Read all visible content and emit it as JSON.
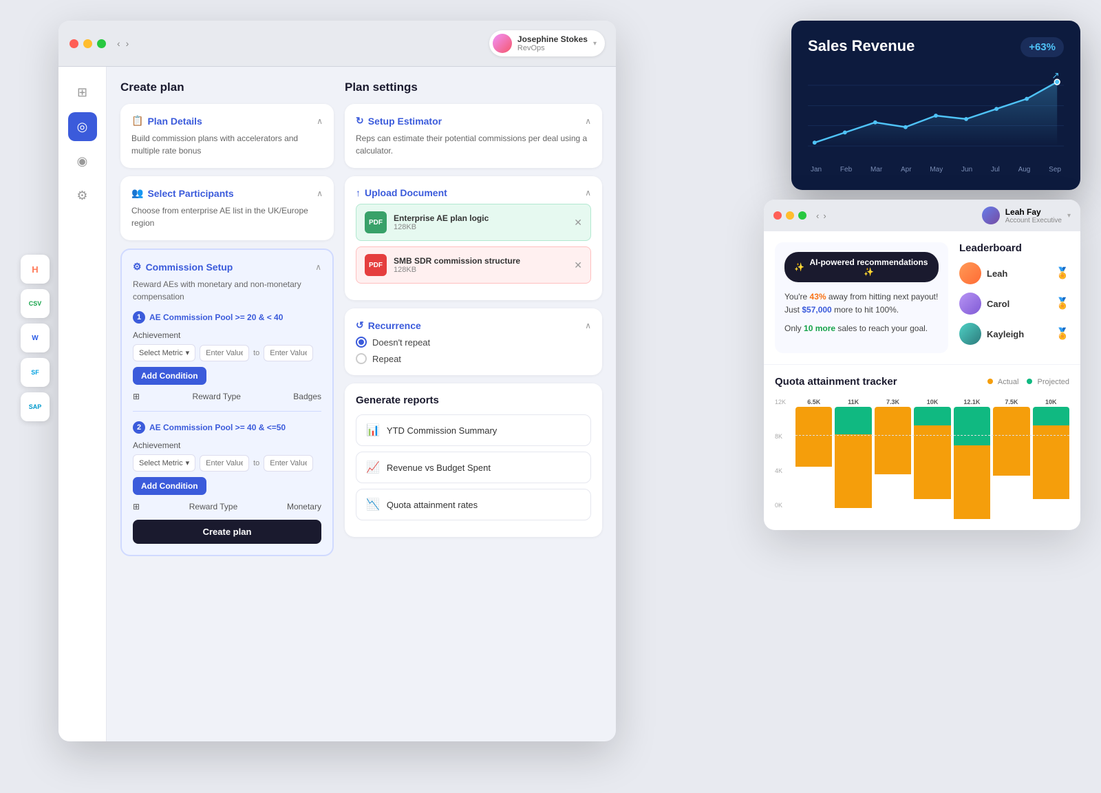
{
  "mainWindow": {
    "title": "Create plan",
    "user": {
      "name": "Josephine Stokes",
      "role": "RevOps"
    }
  },
  "sidebar": {
    "items": [
      {
        "id": "grid",
        "icon": "⊞",
        "label": "Dashboard"
      },
      {
        "id": "target",
        "icon": "◎",
        "label": "Plans",
        "active": true
      },
      {
        "id": "camera",
        "icon": "◉",
        "label": "Media"
      },
      {
        "id": "settings",
        "icon": "⚙",
        "label": "Settings"
      }
    ]
  },
  "integrations": [
    {
      "id": "hubspot",
      "label": "H",
      "color": "#ff7a59",
      "bg": "white"
    },
    {
      "id": "csv",
      "label": "CSV",
      "color": "#16a34a",
      "bg": "white"
    },
    {
      "id": "word",
      "label": "W",
      "color": "#2b5ce6",
      "bg": "white"
    },
    {
      "id": "salesforce",
      "label": "SF",
      "color": "#00a1e0",
      "bg": "white"
    },
    {
      "id": "sap",
      "label": "SAP",
      "color": "#0099cc",
      "bg": "white"
    }
  ],
  "createPlan": {
    "title": "Create plan",
    "sections": {
      "planDetails": {
        "title": "Plan Details",
        "description": "Build commission plans with accelerators and multiple rate bonus",
        "icon": "📋"
      },
      "selectParticipants": {
        "title": "Select Participants",
        "description": "Choose from enterprise AE list in the UK/Europe region",
        "icon": "👥"
      },
      "commissionSetup": {
        "title": "Commission Setup",
        "description": "Reward AEs with monetary and non-monetary compensation",
        "icon": "⚙"
      }
    },
    "pools": [
      {
        "number": "1",
        "label": "AE Commission Pool >= 20 & < 40",
        "achievement": "Achievement",
        "selectMetric": "Select Metric",
        "enterValue1": "Enter Value",
        "enterValue2": "Enter Value",
        "addCondition": "Add Condition",
        "rewardType": "Reward Type",
        "rewardValue": "Badges"
      },
      {
        "number": "2",
        "label": "AE Commission Pool >= 40 & <=50",
        "achievement": "Achievement",
        "selectMetric": "Select Metric",
        "enterValue1": "Enter Value",
        "enterValue2": "Enter Value",
        "addCondition": "Add Condition",
        "rewardType": "Reward Type",
        "rewardValue": "Monetary"
      }
    ],
    "createBtn": "Create plan"
  },
  "planSettings": {
    "title": "Plan settings",
    "setupEstimator": {
      "title": "Setup Estimator",
      "description": "Reps can estimate their potential commissions per deal using a calculator."
    },
    "uploadDocument": {
      "title": "Upload Document",
      "files": [
        {
          "name": "Enterprise AE plan logic",
          "size": "128KB",
          "color": "green"
        },
        {
          "name": "SMB SDR commission structure",
          "size": "128KB",
          "color": "red"
        }
      ]
    },
    "recurrence": {
      "title": "Recurrence",
      "options": [
        {
          "label": "Doesn't repeat",
          "selected": true
        },
        {
          "label": "Repeat",
          "selected": false
        }
      ]
    }
  },
  "generateReports": {
    "title": "Generate reports",
    "reports": [
      {
        "label": "YTD Commission Summary",
        "icon": "📊"
      },
      {
        "label": "Revenue vs Budget Spent",
        "icon": "📈"
      },
      {
        "label": "Quota attainment rates",
        "icon": "📉"
      }
    ]
  },
  "salesRevenue": {
    "title": "Sales Revenue",
    "badge": "+63%",
    "months": [
      "Jan",
      "Feb",
      "Mar",
      "Apr",
      "May",
      "Jun",
      "Jul",
      "Aug",
      "Sep"
    ],
    "chartData": [
      30,
      45,
      60,
      55,
      70,
      65,
      80,
      90,
      110
    ]
  },
  "leaderboardPanel": {
    "user": {
      "name": "Leah Fay",
      "role": "Account Executive"
    },
    "aiRecs": {
      "btnLabel": "AI-powered recommendations ✨",
      "text1": "You're ",
      "highlight1": "43%",
      "text2": " away from hitting next payout! Just ",
      "highlight2": "$57,000",
      "text3": " more to hit 100%.",
      "text4": "Only ",
      "highlight3": "10 more",
      "text5": " sales to reach your goal."
    },
    "leaderboard": {
      "title": "Leaderboard",
      "entries": [
        {
          "name": "Leah",
          "medal": "🏅",
          "avatarColor": "orange"
        },
        {
          "name": "Carol",
          "medal": "🏅",
          "avatarColor": "purple"
        },
        {
          "name": "Kayleigh",
          "medal": "🏅",
          "avatarColor": "teal"
        }
      ]
    },
    "quotaTracker": {
      "title": "Quota attainment tracker",
      "legend": [
        {
          "label": "Actual",
          "color": "#f59e0b"
        },
        {
          "label": "Projected",
          "color": "#10b981"
        }
      ],
      "bars": [
        {
          "month": "",
          "actual": 6500,
          "projected": 0,
          "label": "6.5K",
          "pLabel": ""
        },
        {
          "month": "",
          "actual": 8000,
          "projected": 3000,
          "label": "11K",
          "pLabel": ""
        },
        {
          "month": "",
          "actual": 7300,
          "projected": 0,
          "label": "7.3K",
          "pLabel": ""
        },
        {
          "month": "",
          "actual": 8000,
          "projected": 2000,
          "label": "10K",
          "pLabel": ""
        },
        {
          "month": "",
          "actual": 8000,
          "projected": 4200,
          "label": "12.1K",
          "pLabel": ""
        },
        {
          "month": "",
          "actual": 7500,
          "projected": 0,
          "label": "7.5K",
          "pLabel": ""
        },
        {
          "month": "",
          "actual": 8000,
          "projected": 2000,
          "label": "10K",
          "pLabel": ""
        }
      ],
      "yAxis": [
        "12K",
        "8K",
        "4K",
        "0K"
      ]
    }
  }
}
